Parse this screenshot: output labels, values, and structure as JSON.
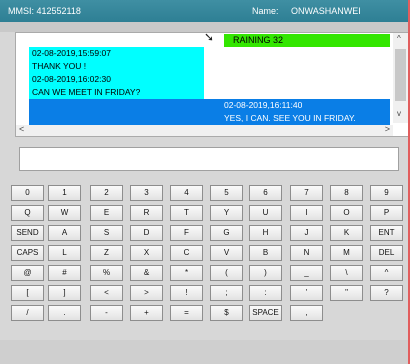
{
  "header": {
    "mmsi": "MMSI: 412552118",
    "name_label": "Name:",
    "name_value": "ONWASHANWEI"
  },
  "chat": {
    "status_text": "RAINING 32",
    "incoming": [
      "02-08-2019,15:59:07",
      "THANK YOU !",
      "02-08-2019,16:02:30",
      "CAN WE MEET IN FRIDAY?"
    ],
    "outgoing": [
      "02-08-2019,16:11:40",
      "YES, I CAN. SEE YOU IN FRIDAY."
    ]
  },
  "input": {
    "value": ""
  },
  "keyboard": {
    "rows": [
      [
        "0",
        "1",
        "2",
        "3",
        "4",
        "5",
        "6",
        "7",
        "8",
        "9"
      ],
      [
        "Q",
        "W",
        "E",
        "R",
        "T",
        "Y",
        "U",
        "I",
        "O",
        "P"
      ],
      [
        "SEND",
        "A",
        "S",
        "D",
        "F",
        "G",
        "H",
        "J",
        "K",
        "ENT"
      ],
      [
        "CAPS",
        "L",
        "Z",
        "X",
        "C",
        "V",
        "B",
        "N",
        "M",
        "DEL"
      ],
      [
        "@",
        "#",
        "%",
        "&",
        "*",
        "(",
        ")",
        "_",
        "\\",
        "^"
      ],
      [
        "[",
        "]",
        "<",
        ">",
        "!",
        ";",
        ":",
        "'",
        "\"",
        "?"
      ],
      [
        "/",
        ".",
        "-",
        "+",
        "=",
        "$",
        "SPACE",
        ",",
        "",
        ""
      ]
    ]
  },
  "colors": {
    "titlebar": "#2e7f94",
    "status_bg": "#33e600",
    "incoming_bg": "#00ffff",
    "outgoing_bg": "#0a7ee6"
  }
}
